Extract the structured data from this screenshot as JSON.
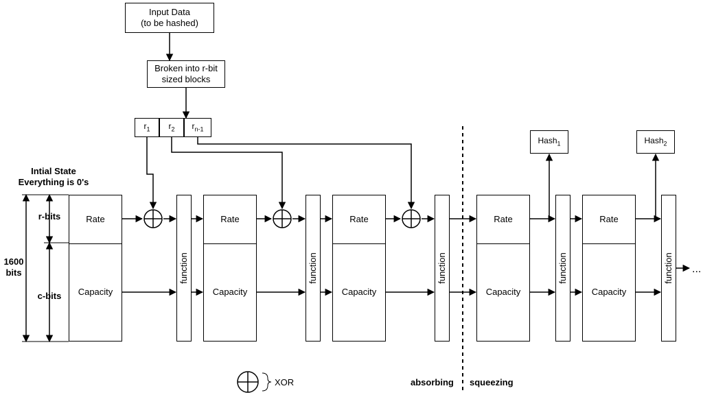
{
  "input": {
    "title_l1": "Input Data",
    "title_l2": "(to be hashed)",
    "broken_l1": "Broken into r-bit",
    "broken_l2": "sized blocks",
    "r1": "r",
    "r1_sub": "1",
    "r2": "r",
    "r2_sub": "2",
    "rn": "r",
    "rn_sub": "n-1"
  },
  "initial": {
    "title_l1": "Intial State",
    "title_l2": "Everything is 0's",
    "whole": "1600 bits",
    "r_bits": "r-bits",
    "c_bits": "c-bits"
  },
  "state": {
    "rate": "Rate",
    "capacity": "Capacity",
    "func": "function"
  },
  "xor": "XOR",
  "phase_a": "absorbing",
  "phase_s": "squeezing",
  "hash1_l": "Hash",
  "hash1_s": "1",
  "hash2_l": "Hash",
  "hash2_s": "2"
}
